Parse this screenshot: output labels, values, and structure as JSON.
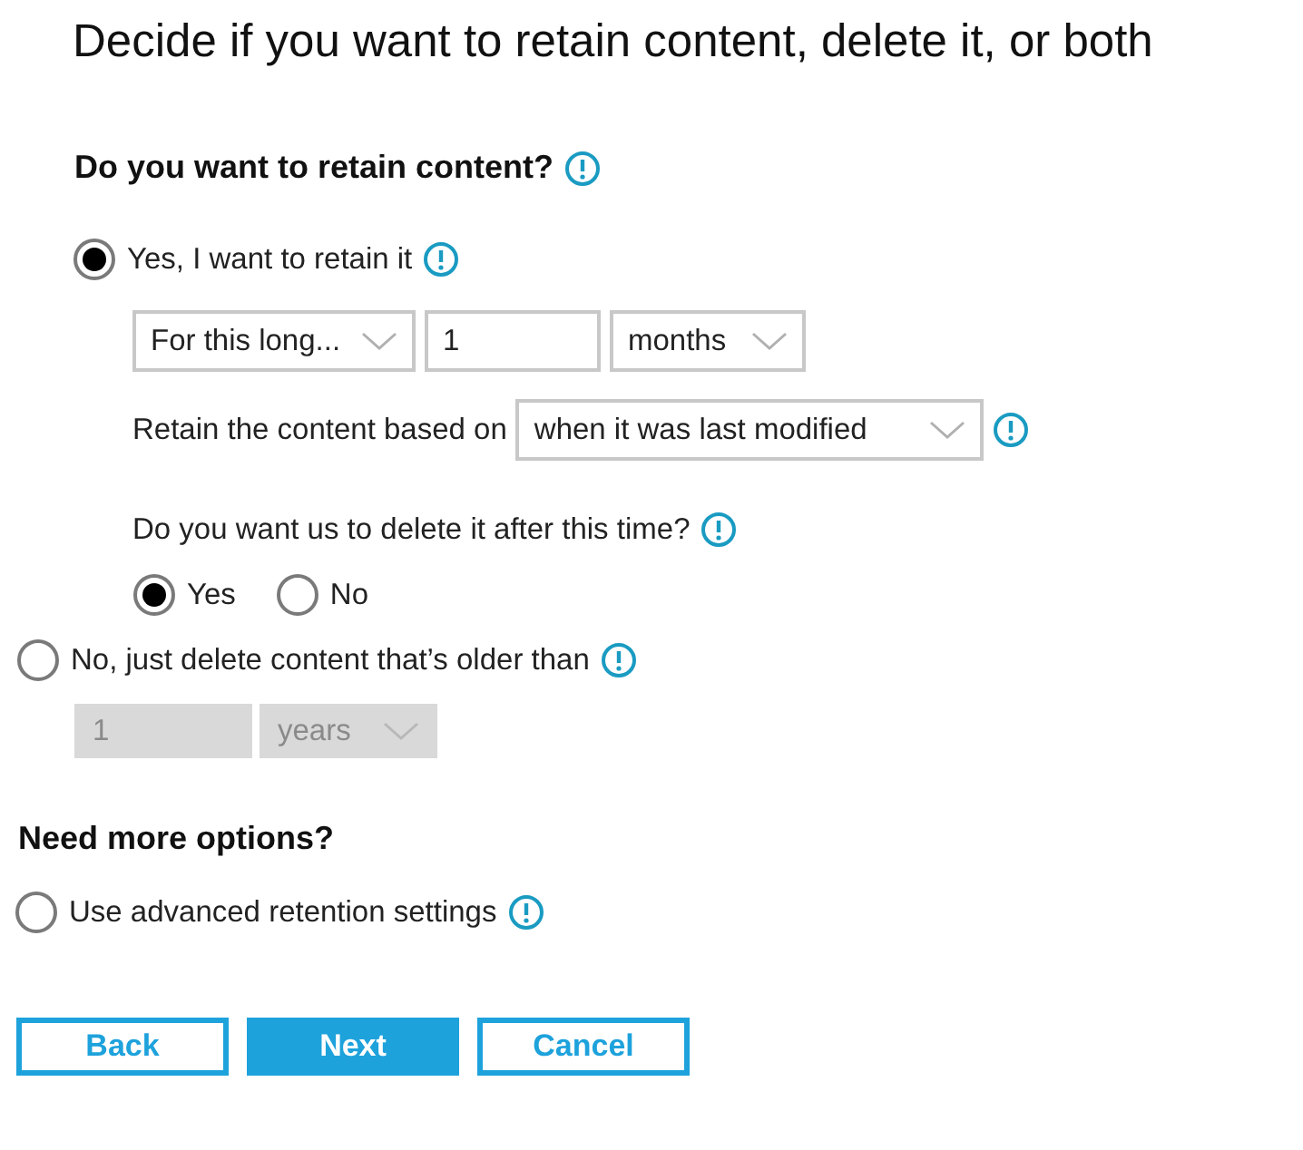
{
  "title": "Decide if you want to retain content, delete it, or both",
  "retain_heading": "Do you want to retain content?",
  "retain_options": [
    {
      "kind": "retain",
      "label": "Yes, I want to retain it",
      "selected": true
    },
    {
      "kind": "delete",
      "label": "No, just delete content that’s older than",
      "selected": false
    }
  ],
  "retain_period": {
    "duration_type": "For this long...",
    "value": "1",
    "unit": "months"
  },
  "based_on": {
    "label": "Retain the content based on",
    "value": "when it was last modified"
  },
  "delete_after": {
    "question": "Do you want us to delete it after this time?",
    "options": [
      {
        "label": "Yes",
        "selected": true
      },
      {
        "label": "No",
        "selected": false
      }
    ]
  },
  "delete_period": {
    "value": "1",
    "unit": "years",
    "disabled": true
  },
  "more_options": {
    "heading": "Need more options?",
    "option": {
      "label": "Use advanced retention settings",
      "selected": false
    }
  },
  "buttons": [
    {
      "label": "Back",
      "kind": "secondary"
    },
    {
      "label": "Next",
      "kind": "primary"
    },
    {
      "label": "Cancel",
      "kind": "secondary"
    }
  ]
}
